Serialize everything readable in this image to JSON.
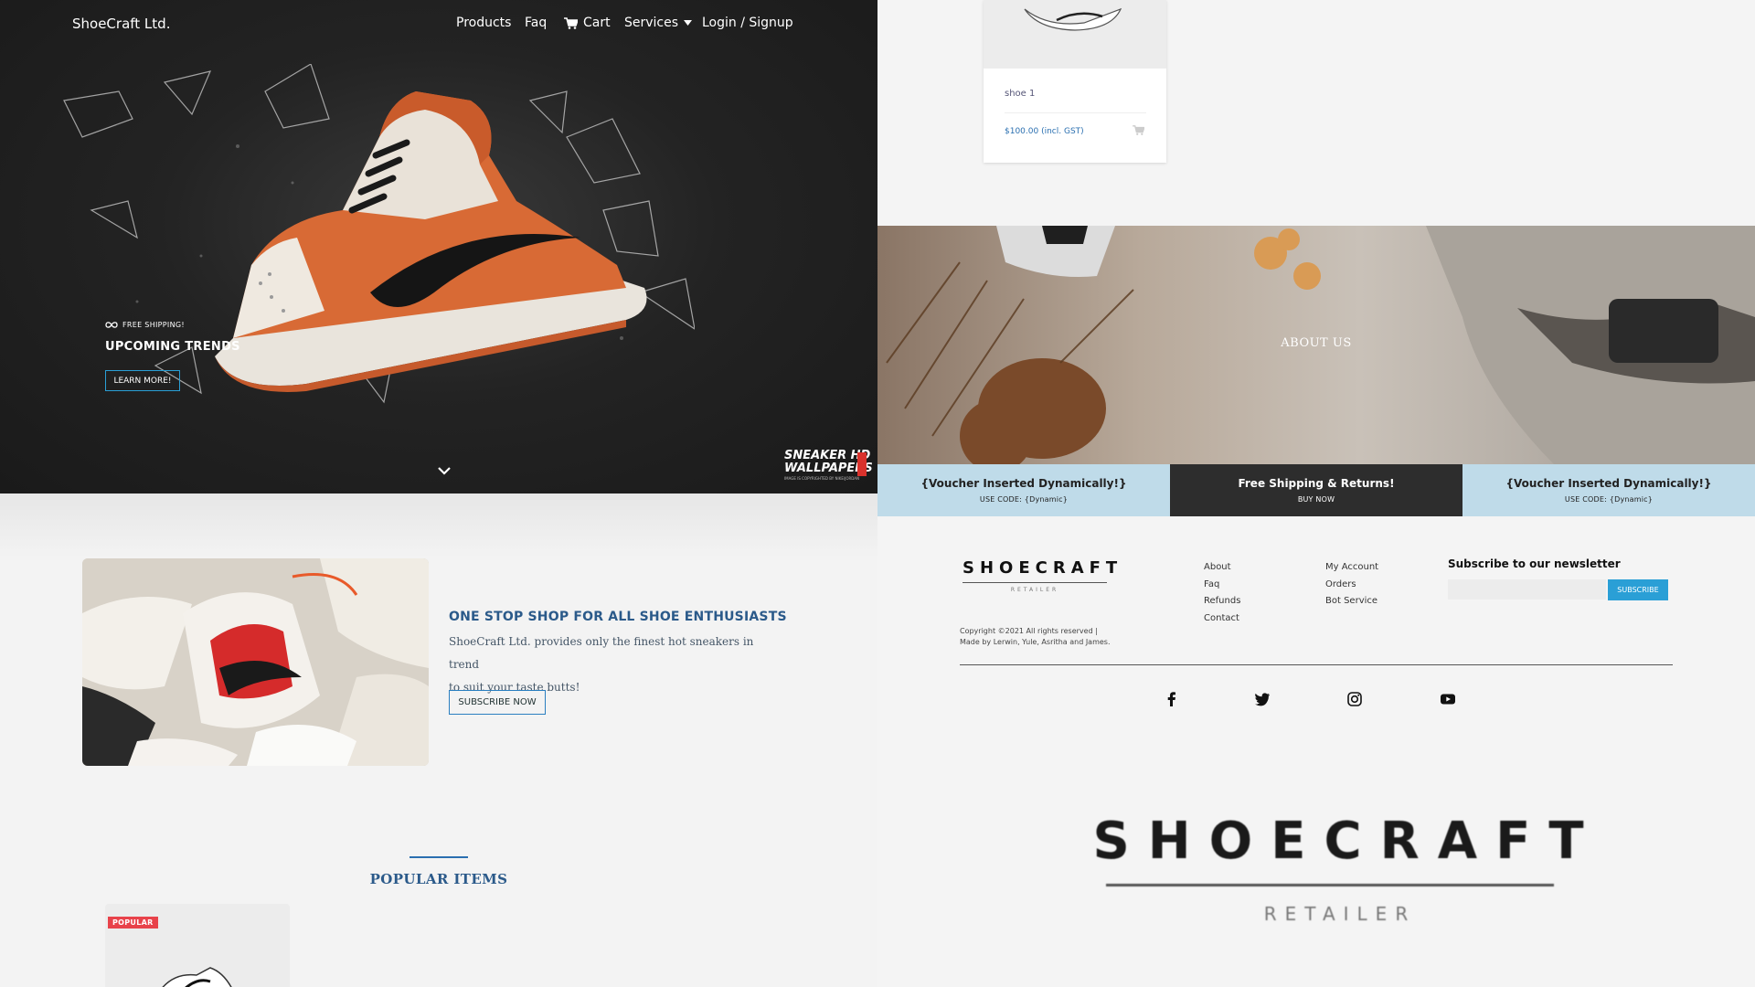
{
  "left": {
    "brand": "ShoeCraft Ltd.",
    "nav": {
      "products": "Products",
      "faq": "Faq",
      "cart": "Cart",
      "services": "Services",
      "login": "Login / Signup"
    },
    "hero": {
      "badge": "FREE SHIPPING!",
      "title": "UPCOMING TRENDS",
      "button": "LEARN MORE!",
      "watermark_line1": "SNEAKER HD",
      "watermark_line2": "WALLPAPERS",
      "watermark_small": "IMAGE IS COPYRIGHTED BY NIKE/JORDAN"
    },
    "promo": {
      "title": "ONE STOP SHOP FOR ALL SHOE ENTHUSIASTS",
      "line1": "ShoeCraft Ltd. provides only the finest hot sneakers in trend",
      "line2": "to suit your taste butts!",
      "button": "SUBSCRIBE NOW"
    },
    "popular": {
      "title": "POPULAR ITEMS",
      "badge": "POPULAR"
    }
  },
  "right": {
    "product": {
      "name": "shoe 1",
      "price": "$100.00 (incl. GST)"
    },
    "about": {
      "title": "ABOUT US"
    },
    "vouchers": [
      {
        "title": "{Voucher Inserted Dynamically!}",
        "sub": "USE CODE: {Dynamic}"
      },
      {
        "title": "Free Shipping & Returns!",
        "sub": "BUY NOW"
      },
      {
        "title": "{Voucher Inserted Dynamically!}",
        "sub": "USE CODE: {Dynamic}"
      }
    ],
    "footer": {
      "logo_word": "SHOECRAFT",
      "logo_sub": "RETAILER",
      "copyright": "Copyright ©2021 All rights reserved | Made by Lerwin, Yule, Asritha and James.",
      "col1": [
        "About",
        "Faq",
        "Refunds",
        "Contact"
      ],
      "col2": [
        "My Account",
        "Orders",
        "Bot Service"
      ],
      "newsletter_title": "Subscribe to our newsletter",
      "newsletter_button": "SUBSCRIBE",
      "social_icons": [
        "facebook-icon",
        "twitter-icon",
        "instagram-icon",
        "youtube-icon"
      ]
    },
    "big_logo": {
      "word": "SHOECRAFT",
      "sub": "RETAILER"
    }
  },
  "colors": {
    "hero_bg": "#1f1f1f",
    "accent_blue": "#2a9fd6",
    "heading_blue": "#2b5a8a",
    "voucher_light": "#bfdbe9",
    "voucher_dark": "#2d2d2d",
    "popular_red": "#e8424a"
  }
}
